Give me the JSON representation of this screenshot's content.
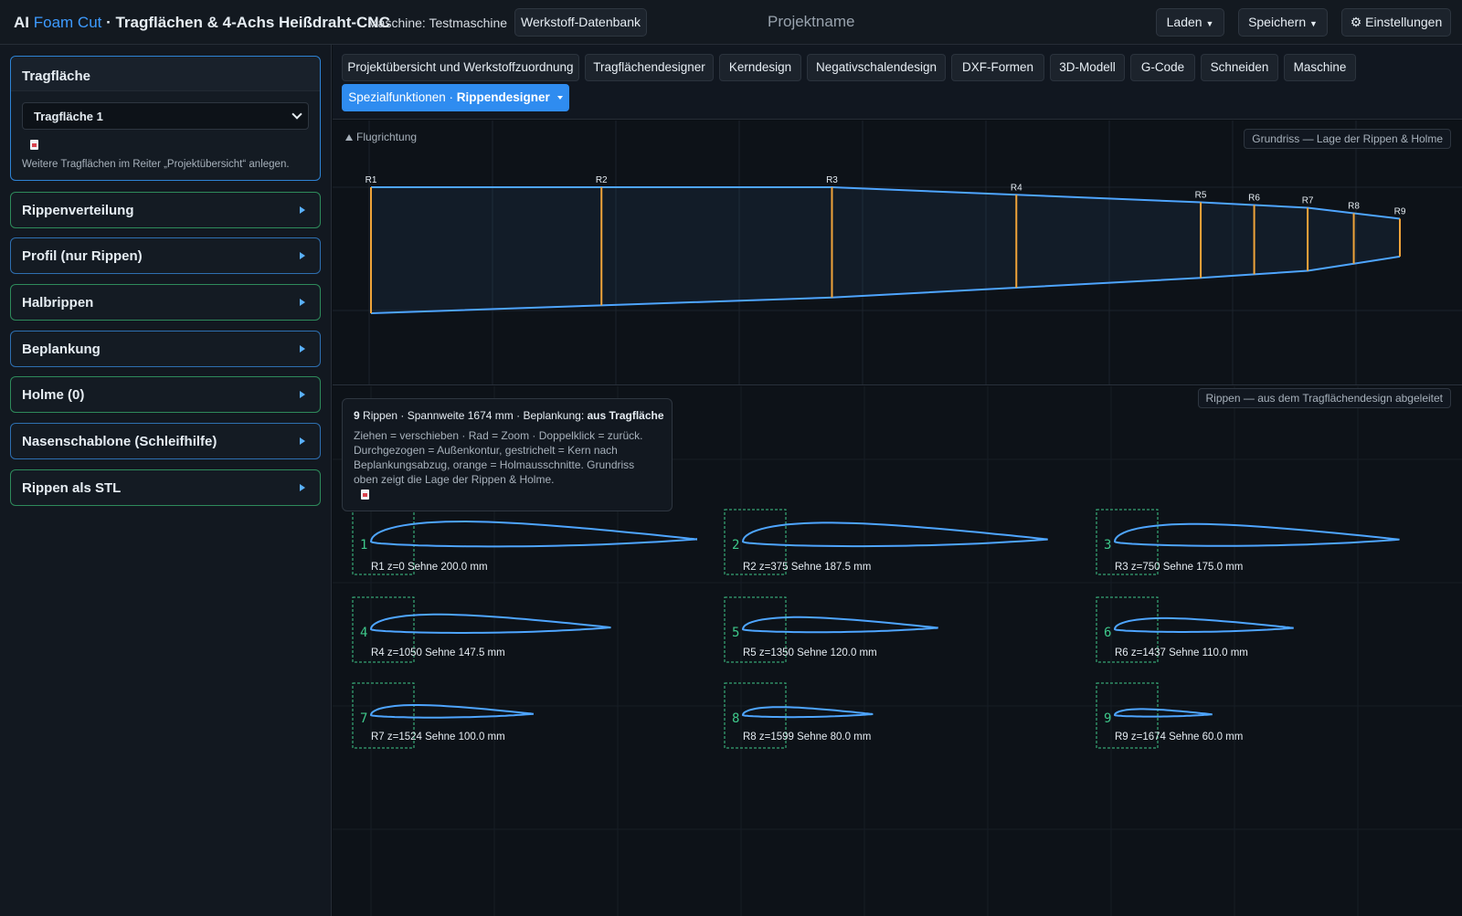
{
  "header": {
    "brand_prefix": "AI ",
    "brand_accent": "Foam Cut",
    "brand_suffix": " · Tragflächen & 4-Achs Heißdraht-CNC",
    "machine": "Maschine: Testmaschine",
    "db_button": "Werkstoff-Datenbank",
    "project_name": "Projektname",
    "load_button": "Laden",
    "save_button": "Speichern",
    "settings_button": "⚙ Einstellungen"
  },
  "sidebar": {
    "main_title": "Tragfläche",
    "select_value": "Tragfläche 1",
    "hint": "Weitere Tragflächen im Reiter „Projektübersicht“ anlegen.",
    "sections": [
      "Rippenverteilung",
      "Profil (nur Rippen)",
      "Halbrippen",
      "Beplankung",
      "Holme (0)",
      "Nasenschablone (Schleifhilfe)",
      "Rippen als STL"
    ]
  },
  "tabs": {
    "items": [
      "Projektübersicht und Werkstoffzuordnung",
      "Tragflächendesigner",
      "Kerndesign",
      "Negativschalendesign",
      "DXF-Formen",
      "3D-Modell",
      "G-Code",
      "Schneiden",
      "Maschine"
    ],
    "active_prefix": "Spezialfunktionen · ",
    "active_label": "Rippendesigner"
  },
  "planform": {
    "direction_label": "Flugrichtung",
    "badge": "Grundriss — Lage der Rippen & Holme"
  },
  "ribs_view": {
    "badge": "Rippen — aus dem Tragflächendesign abgeleitet",
    "info_count": "9",
    "info_text": " Rippen · Spannweite 1674 mm · Beplankung: ",
    "info_bold": "aus Tragfläche",
    "info_hint": "Ziehen = verschieben · Rad = Zoom · Doppelklick = zurück. Durchgezogen = Außenkontur, gestrichelt = Kern nach Beplankungsabzug, orange = Holmausschnitte. Grundriss oben zeigt die Lage der Rippen & Holme."
  },
  "ribs": [
    {
      "id": "R1",
      "number": "1",
      "label": "R1  z=0  Sehne 200.0 mm",
      "z": 0,
      "chord": 200.0
    },
    {
      "id": "R2",
      "number": "2",
      "label": "R2  z=375  Sehne 187.5 mm",
      "z": 375,
      "chord": 187.5
    },
    {
      "id": "R3",
      "number": "3",
      "label": "R3  z=750  Sehne 175.0 mm",
      "z": 750,
      "chord": 175.0
    },
    {
      "id": "R4",
      "number": "4",
      "label": "R4  z=1050  Sehne 147.5 mm",
      "z": 1050,
      "chord": 147.5
    },
    {
      "id": "R5",
      "number": "5",
      "label": "R5  z=1350  Sehne 120.0 mm",
      "z": 1350,
      "chord": 120.0
    },
    {
      "id": "R6",
      "number": "6",
      "label": "R6  z=1437  Sehne 110.0 mm",
      "z": 1437,
      "chord": 110.0
    },
    {
      "id": "R7",
      "number": "7",
      "label": "R7  z=1524  Sehne 100.0 mm",
      "z": 1524,
      "chord": 100.0
    },
    {
      "id": "R8",
      "number": "8",
      "label": "R8  z=1599  Sehne 80.0 mm",
      "z": 1599,
      "chord": 80.0
    },
    {
      "id": "R9",
      "number": "9",
      "label": "R9  z=1674  Sehne 60.0 mm",
      "z": 1674,
      "chord": 60.0
    }
  ],
  "colors": {
    "accent": "#3d9bff",
    "outline": "#4ea5ff",
    "spar": "#f0a43a",
    "core": "#3ec88a"
  }
}
